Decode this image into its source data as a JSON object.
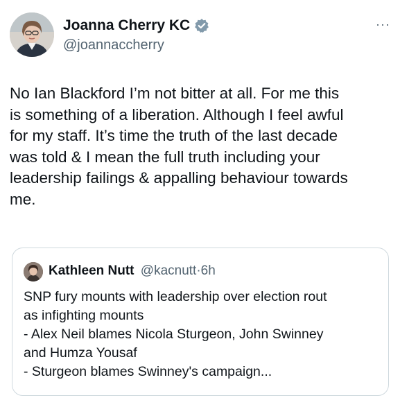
{
  "tweet": {
    "author": {
      "name": "Joanna Cherry KC",
      "handle": "@joannaccherry",
      "verified": true,
      "avatar_icon": "profile-photo"
    },
    "more_icon": "more-dots-icon",
    "more_label": "···",
    "text": "No Ian Blackford I’m not bitter at all. For me this\nis something of a liberation. Although I feel awful\nfor my staff. It’s time the truth of the last decade\nwas told & I mean the full truth including your\nleadership failings & appalling behaviour towards\nme.",
    "quoted": {
      "author": {
        "name": "Kathleen Nutt",
        "handle": "@kacnutt",
        "separator": "·",
        "time": "6h"
      },
      "text": "SNP fury mounts with leadership over election rout\nas infighting mounts\n- Alex Neil blames Nicola Sturgeon, John Swinney\nand Humza Yousaf\n- Sturgeon blames Swinney's campaign..."
    }
  },
  "colors": {
    "text": "#0f1419",
    "secondary": "#536471",
    "verified_badge": "#829aab",
    "border": "#cfd9de"
  }
}
